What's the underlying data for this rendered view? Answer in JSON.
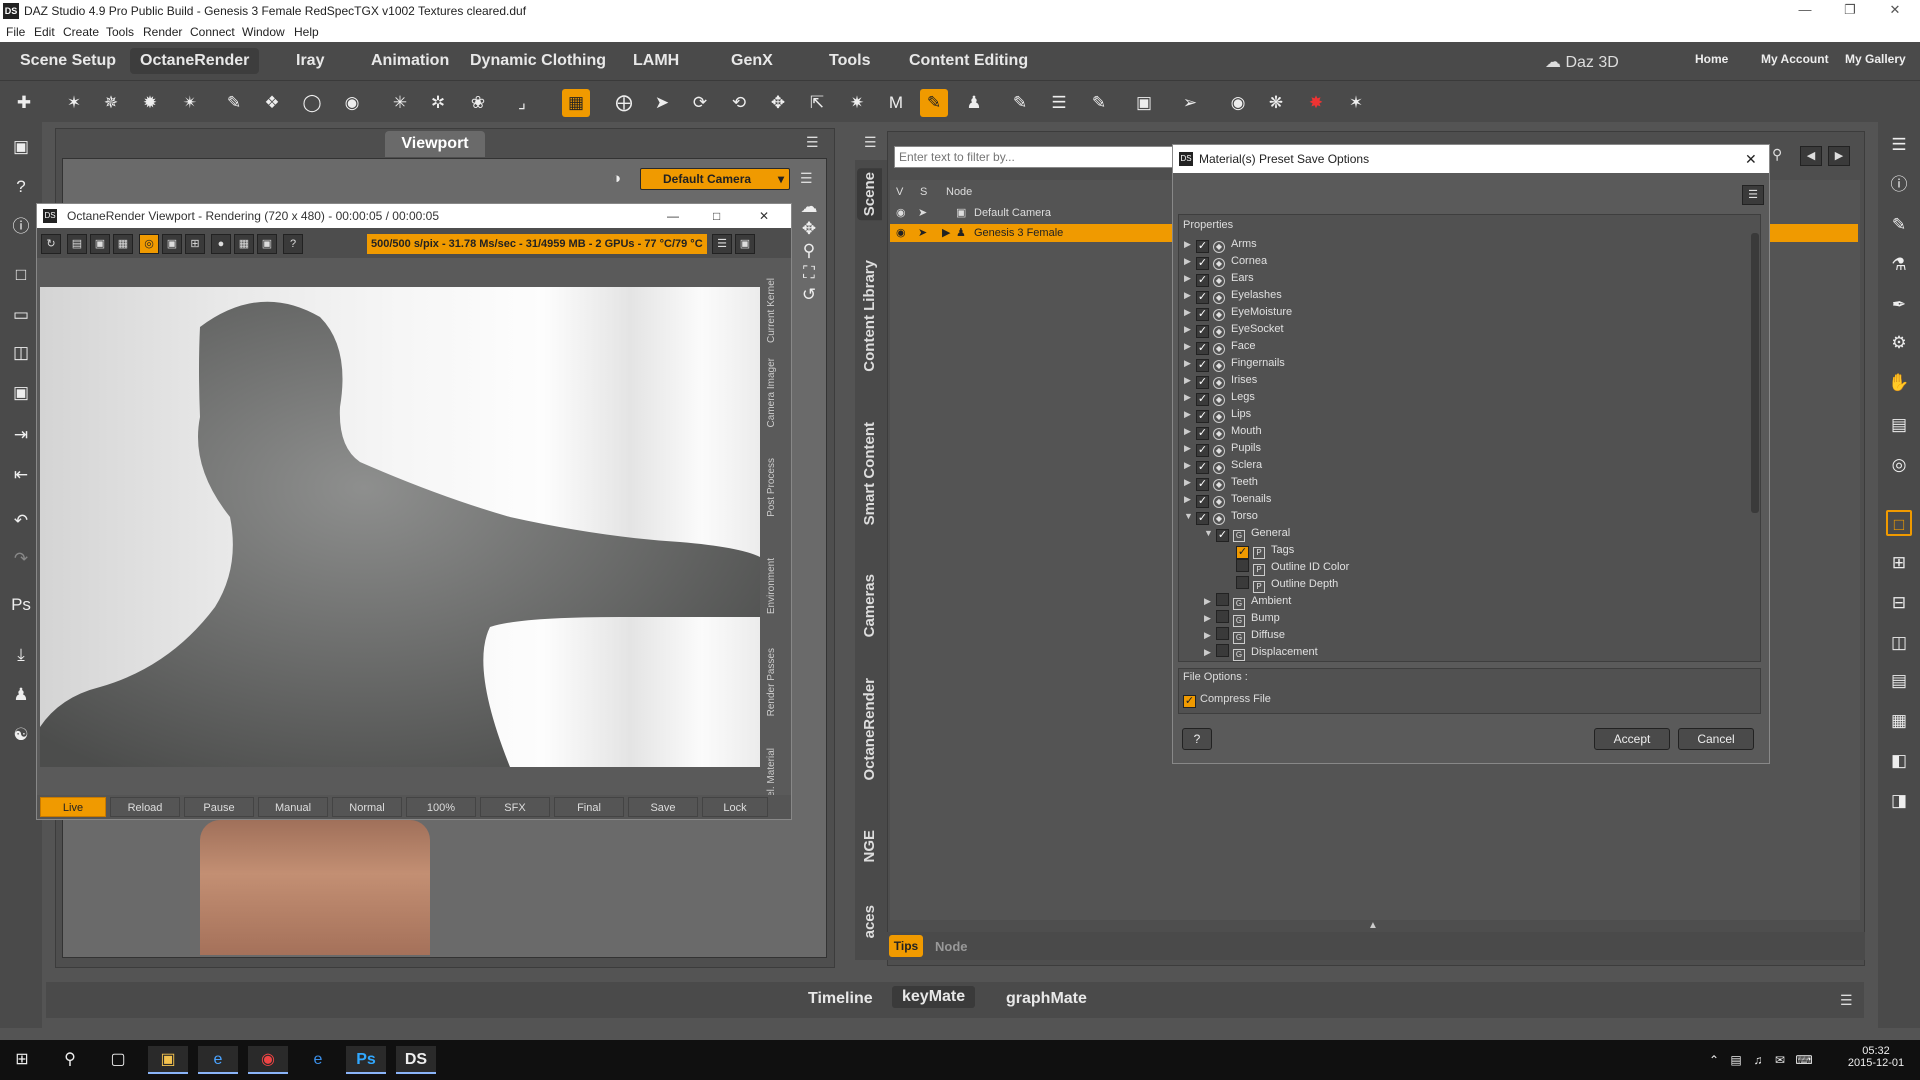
{
  "window": {
    "title": "DAZ Studio 4.9 Pro Public Build - Genesis 3 Female RedSpecTGX v1002 Textures cleared.duf",
    "app_icon": "DS"
  },
  "menu": [
    "File",
    "Edit",
    "Create",
    "Tools",
    "Render",
    "Connect",
    "Window",
    "Help"
  ],
  "workspace_tabs": [
    "Scene Setup",
    "OctaneRender",
    "Iray",
    "Animation",
    "Dynamic Clothing",
    "LAMH",
    "GenX",
    "Tools",
    "Content Editing"
  ],
  "active_workspace": "OctaneRender",
  "brand": "Daz 3D",
  "top_links": [
    "Home",
    "My Account",
    "My Gallery"
  ],
  "viewport": {
    "tab": "Viewport",
    "camera": "Default Camera"
  },
  "octane": {
    "title": "OctaneRender Viewport - Rendering (720 x 480) - 00:00:05 / 00:00:05",
    "status": "500/500 s/pix - 31.78 Ms/sec - 31/4959 MB - 2 GPUs - 77 °C/79 °C",
    "side_tabs": [
      "Current Kernel",
      "Camera Imager",
      "Post Process",
      "Environment",
      "Render Passes",
      "Sel. Material"
    ],
    "bottom_buttons": [
      "Live",
      "Reload",
      "Pause",
      "Manual",
      "Normal",
      "100%",
      "SFX",
      "Final",
      "Save",
      "Lock"
    ]
  },
  "scene": {
    "side_tabs": [
      "Scene",
      "Content Library",
      "Smart Content",
      "Cameras",
      "OctaneRender",
      "NGE",
      "aces"
    ],
    "filter_placeholder": "Enter text to filter by...",
    "columns": [
      "V",
      "S",
      "Node"
    ],
    "rows": [
      "Default Camera",
      "Genesis 3 Female"
    ],
    "tips_tabs": [
      "Tips",
      "Node"
    ]
  },
  "dialog": {
    "title": "Material(s) Preset Save Options",
    "properties_label": "Properties",
    "groups": [
      "Arms",
      "Cornea",
      "Ears",
      "Eyelashes",
      "EyeMoisture",
      "EyeSocket",
      "Face",
      "Fingernails",
      "Irises",
      "Legs",
      "Lips",
      "Mouth",
      "Pupils",
      "Sclera",
      "Teeth",
      "Toenails",
      "Torso"
    ],
    "torso_children": {
      "general": "General",
      "general_props": [
        "Tags",
        "Outline ID Color",
        "Outline Depth"
      ],
      "others": [
        "Ambient",
        "Bump",
        "Diffuse",
        "Displacement"
      ]
    },
    "file_options_label": "File Options :",
    "compress_label": "Compress File",
    "help": "?",
    "accept": "Accept",
    "cancel": "Cancel"
  },
  "bottom_tabs": [
    "Timeline",
    "keyMate",
    "graphMate"
  ],
  "taskbar": {
    "time": "05:32",
    "date": "2015-12-01"
  },
  "colors": {
    "accent": "#f09a00",
    "panel": "#4e4e4e",
    "background": "#545454"
  }
}
